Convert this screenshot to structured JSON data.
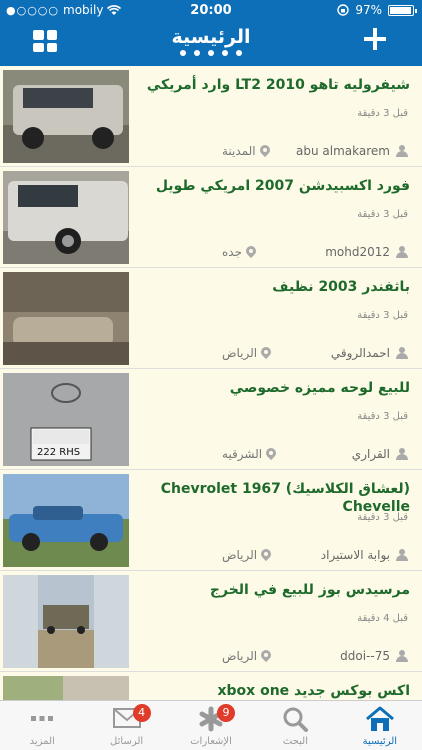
{
  "status": {
    "carrier": "mobily",
    "time": "20:00",
    "battery": "97%"
  },
  "nav": {
    "title": "الرئيسية"
  },
  "listings": [
    {
      "title": "شيفروليه تاهو LT2 2010 وارد أمريكي",
      "time_ago": "قبل 3 دقيقة",
      "user": "abu almakarem",
      "city": "المدينة"
    },
    {
      "title": "فورد اكسبيدشن 2007 امريكي طويل",
      "time_ago": "قبل 3 دقيقة",
      "user": "mohd2012",
      "city": "جده"
    },
    {
      "title": "باثفندر 2003 نظيف",
      "time_ago": "قبل 3 دقيقة",
      "user": "احمدالروقي",
      "city": "الرياض"
    },
    {
      "title": "للبيع لوحه مميزه خصوصي",
      "time_ago": "قبل 3 دقيقة",
      "user": "القراري",
      "city": "الشرقيه"
    },
    {
      "title": "(لعشاق الكلاسيك) Chevrolet 1967 Chevelle",
      "time_ago": "قبل 3 دقيقة",
      "user": "بوابة الاستيراد",
      "city": "الرياض"
    },
    {
      "title": "مرسيدس بوز للبيع في الخرج",
      "time_ago": "قبل 4 دقيقة",
      "user": "ddoi--75",
      "city": "الرياض"
    },
    {
      "title": "اكس بوكس جديد xbox one",
      "time_ago": "",
      "user": "",
      "city": ""
    }
  ],
  "tabs": [
    {
      "label": "المزيد",
      "icon": "more-icon",
      "badge": ""
    },
    {
      "label": "الرسائل",
      "icon": "mail-icon",
      "badge": "4"
    },
    {
      "label": "الإشعارات",
      "icon": "asterisk-icon",
      "badge": "9"
    },
    {
      "label": "البحث",
      "icon": "search-icon",
      "badge": ""
    },
    {
      "label": "الرئيسية",
      "icon": "home-icon",
      "badge": ""
    }
  ],
  "colors": {
    "brand": "#0d6fb8",
    "title_green": "#1e6a2c",
    "card_bg": "#fdfbe7",
    "badge_red": "#e13b2a"
  }
}
